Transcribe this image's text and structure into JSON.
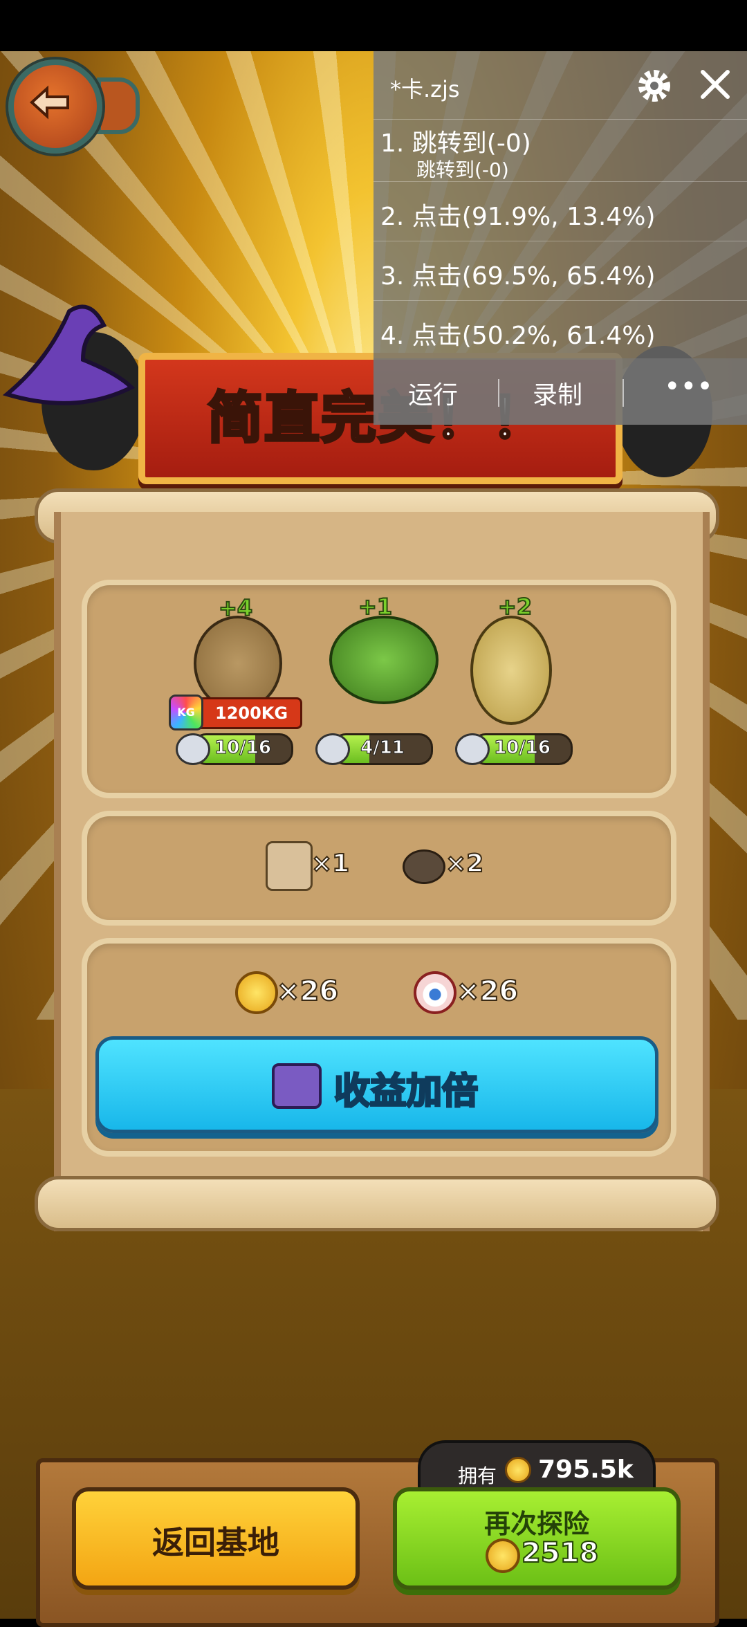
{
  "overlay": {
    "title": "*卡.zjs",
    "steps": [
      {
        "main": "1. 跳转到(-0)",
        "sub": "跳转到(-0)"
      },
      {
        "main": "2. 点击(91.9%, 13.4%)"
      },
      {
        "main": "3. 点击(69.5%, 65.4%)"
      },
      {
        "main": "4. 点击(50.2%, 61.4%)"
      }
    ],
    "run_label": "运行",
    "record_label": "录制",
    "more_label": "•••"
  },
  "banner": {
    "title": "简直完美！！"
  },
  "crops": [
    {
      "name": "potato-sack",
      "bonus": "+4",
      "weight": "1200KG",
      "kg_icon": "KG",
      "progress_text": "10/16",
      "progress": 0.625
    },
    {
      "name": "cactus",
      "bonus": "+1",
      "progress_text": "4/11",
      "progress": 0.364
    },
    {
      "name": "wheat",
      "bonus": "+2",
      "progress_text": "10/16",
      "progress": 0.625
    }
  ],
  "materials": [
    {
      "icon": "cloth-icon",
      "count": "×1"
    },
    {
      "icon": "worm-icon",
      "count": "×2"
    }
  ],
  "rewards": [
    {
      "icon": "coin-icon",
      "count": "×26"
    },
    {
      "icon": "eyeball-icon",
      "count": "×26"
    }
  ],
  "double_button": {
    "label": "收益加倍"
  },
  "bottom": {
    "home_label": "返回基地",
    "owned_label": "拥有",
    "owned_value": "795.5k",
    "again_label": "再次探险",
    "again_cost": "2518"
  },
  "colors": {
    "accent_blue": "#18b7ea",
    "accent_green": "#6cc016",
    "accent_yellow": "#f3a513",
    "banner_red": "#c22b16"
  }
}
